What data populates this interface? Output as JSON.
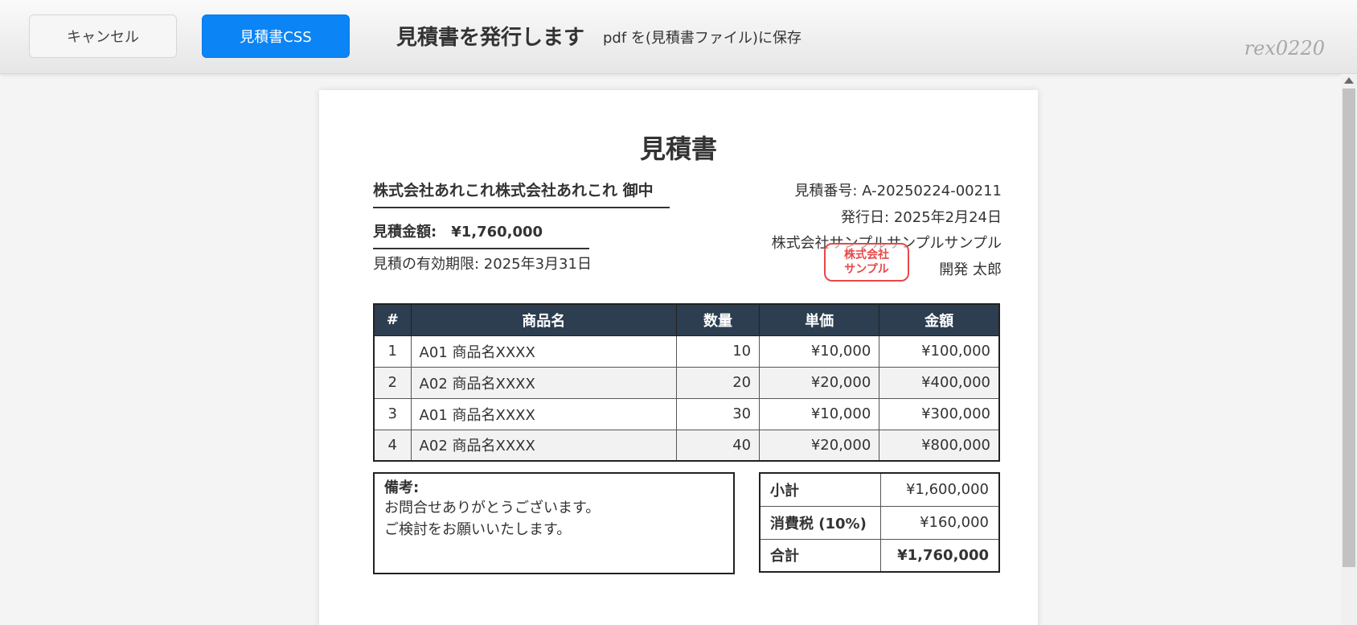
{
  "toolbar": {
    "cancel_label": "キャンセル",
    "css_label": "見積書CSS",
    "title": "見積書を発行します",
    "subtitle": "pdf を(見積書ファイル)に保存",
    "brand": "rex0220"
  },
  "document": {
    "title": "見積書",
    "client": "株式会社あれこれ株式会社あれこれ 御中",
    "amount_label": "見積金額:",
    "amount_value": "¥1,760,000",
    "validity": "見積の有効期限: 2025年3月31日",
    "issuer": {
      "number": "見積番号: A-20250224-00211",
      "date": "発行日: 2025年2月24日",
      "company": "株式会社サンプルサンプルサンプル",
      "person": "開発 太郎"
    },
    "stamp": {
      "line1": "株式会社",
      "line2": "サンプル",
      "color": "#e84848"
    },
    "table": {
      "headers": [
        "#",
        "商品名",
        "数量",
        "単価",
        "金額"
      ],
      "rows": [
        {
          "no": "1",
          "name": "A01 商品名XXXX",
          "qty": "10",
          "price": "¥10,000",
          "amount": "¥100,000"
        },
        {
          "no": "2",
          "name": "A02 商品名XXXX",
          "qty": "20",
          "price": "¥20,000",
          "amount": "¥400,000"
        },
        {
          "no": "3",
          "name": "A01 商品名XXXX",
          "qty": "30",
          "price": "¥10,000",
          "amount": "¥300,000"
        },
        {
          "no": "4",
          "name": "A02 商品名XXXX",
          "qty": "40",
          "price": "¥20,000",
          "amount": "¥800,000"
        }
      ],
      "header_color": "#2c3e50"
    },
    "notes": {
      "title": "備考:",
      "line1": "お問合せありがとうございます。",
      "line2": "ご検討をお願いいたします。"
    },
    "totals": {
      "subtotal_label": "小計",
      "subtotal_value": "¥1,600,000",
      "tax_label": "消費税 (10%)",
      "tax_value": "¥160,000",
      "total_label": "合計",
      "total_value": "¥1,760,000"
    }
  },
  "colors": {
    "primary_button": "#0b84f5"
  }
}
